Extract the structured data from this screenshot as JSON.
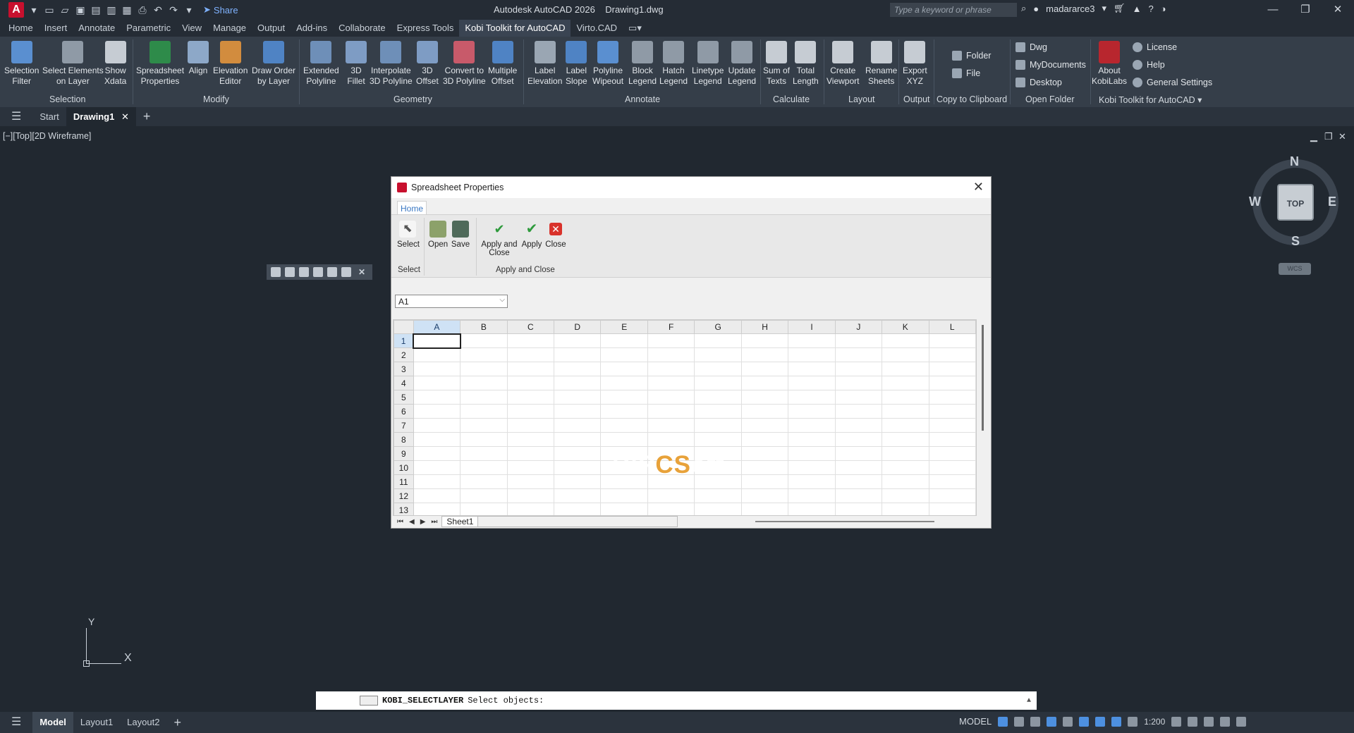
{
  "app": {
    "title": "Autodesk AutoCAD 2026",
    "document": "Drawing1.dwg",
    "share_label": "Share",
    "search_placeholder": "Type a keyword or phrase",
    "user": "madararce3",
    "logo": "A"
  },
  "ribbon_tabs": [
    "Home",
    "Insert",
    "Annotate",
    "Parametric",
    "View",
    "Manage",
    "Output",
    "Add-ins",
    "Collaborate",
    "Express Tools",
    "Kobi Toolkit for AutoCAD",
    "Virto.CAD"
  ],
  "ribbon": {
    "selection": {
      "label": "Selection",
      "tools": [
        "Selection\nFilter",
        "Select Elements\non Layer"
      ]
    },
    "modify": {
      "label": "Modify",
      "tools": [
        "Show\nXdata",
        "Spreadsheet\nProperties",
        "Align",
        "Elevation\nEditor",
        "Draw Order\nby Layer"
      ]
    },
    "geometry": {
      "label": "Geometry",
      "tools": [
        "Extended\nPolyline",
        "3D\nFillet",
        "Interpolate\n3D Polyline",
        "3D\nOffset",
        "Convert to\n3D Polyline",
        "Multiple\nOffset"
      ]
    },
    "annotate": {
      "label": "Annotate",
      "tools": [
        "Label\nElevation",
        "Label\nSlope",
        "Polyline\nWipeout",
        "Block\nLegend",
        "Hatch\nLegend",
        "Linetype\nLegend",
        "Update\nLegend"
      ]
    },
    "calculate": {
      "label": "Calculate",
      "tools": [
        "Sum of\nTexts",
        "Total\nLength"
      ]
    },
    "layout": {
      "label": "Layout",
      "tools": [
        "Create\nViewport",
        "Rename\nSheets"
      ]
    },
    "output": {
      "label": "Output",
      "tools": [
        "Export\nXYZ"
      ]
    },
    "clipboard": {
      "label": "Copy to Clipboard",
      "items": [
        "Folder",
        "File"
      ]
    },
    "open_folder": {
      "label": "Open Folder",
      "items": [
        "Dwg",
        "MyDocuments",
        "Desktop"
      ]
    },
    "kobi": {
      "label": "Kobi Toolkit for AutoCAD",
      "about": "About\nKobiLabs",
      "items": [
        "License",
        "Help",
        "General Settings"
      ]
    }
  },
  "doc_tabs": {
    "start": "Start",
    "drawing": "Drawing1"
  },
  "viewport_label": "[−][Top][2D Wireframe]",
  "viewcube": {
    "n": "N",
    "s": "S",
    "e": "E",
    "w": "W",
    "top": "TOP",
    "wcs": "WCS"
  },
  "dialog": {
    "title": "Spreadsheet Properties",
    "tab": "Home",
    "tools": {
      "select": "Select",
      "open": "Open",
      "save": "Save",
      "apply_close": "Apply and\nClose",
      "apply": "Apply",
      "close": "Close"
    },
    "groups": {
      "select": "Select",
      "apply_close": "Apply and Close"
    },
    "cell_ref": "A1",
    "columns": [
      "A",
      "B",
      "C",
      "D",
      "E",
      "F",
      "G",
      "H",
      "I",
      "J",
      "K",
      "L"
    ],
    "rows": [
      "1",
      "2",
      "3",
      "4",
      "5",
      "6",
      "7",
      "8",
      "9",
      "10",
      "11",
      "12",
      "13"
    ],
    "sheet": "Sheet1"
  },
  "watermark": {
    "prefix": "DiP",
    "mid": "CS",
    "suffix": "oft",
    "accent": "#e8a23a"
  },
  "ucs": {
    "x": "X",
    "y": "Y"
  },
  "command": {
    "name": "KOBI_SELECTLAYER",
    "prompt": "Select objects:"
  },
  "status": {
    "tabs": [
      "Model",
      "Layout1",
      "Layout2"
    ],
    "mode": "MODEL",
    "scale": "1:200"
  }
}
